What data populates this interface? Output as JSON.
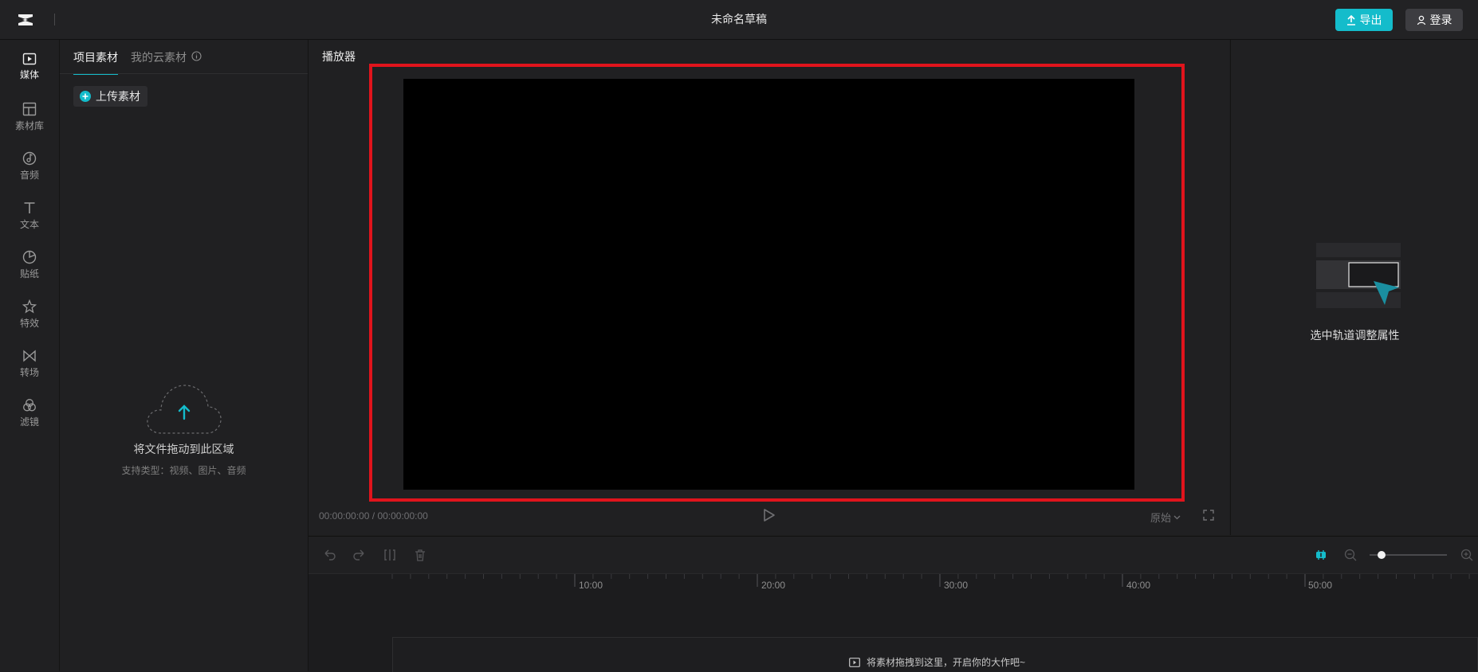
{
  "header": {
    "title": "未命名草稿",
    "export_label": "导出",
    "login_label": "登录"
  },
  "left_nav": {
    "items": [
      {
        "label": "媒体",
        "icon": "media-icon"
      },
      {
        "label": "素材库",
        "icon": "library-icon"
      },
      {
        "label": "音频",
        "icon": "audio-icon"
      },
      {
        "label": "文本",
        "icon": "text-icon"
      },
      {
        "label": "贴纸",
        "icon": "sticker-icon"
      },
      {
        "label": "特效",
        "icon": "effects-icon"
      },
      {
        "label": "转场",
        "icon": "transition-icon"
      },
      {
        "label": "滤镜",
        "icon": "filter-icon"
      }
    ],
    "active_index": 0
  },
  "media_panel": {
    "tabs": [
      "项目素材",
      "我的云素材"
    ],
    "active_tab": 0,
    "upload_label": "上传素材",
    "drop_text": "将文件拖动到此区域",
    "drop_subtext": "支持类型：视频、图片、音频"
  },
  "player": {
    "title": "播放器",
    "current_time": "00:00:00:00",
    "time_separator": "/",
    "total_time": "00:00:00:00",
    "ratio_label": "原始"
  },
  "properties": {
    "hint": "选中轨道调整属性"
  },
  "timeline": {
    "tick_labels": [
      "10:00",
      "20:00",
      "30:00",
      "40:00",
      "50:00"
    ],
    "drop_hint": "将素材拖拽到这里，开启你的大作吧~"
  },
  "colors": {
    "accent": "#14bccb",
    "highlight_border": "#e0141c",
    "background": "#1e1e1f"
  }
}
